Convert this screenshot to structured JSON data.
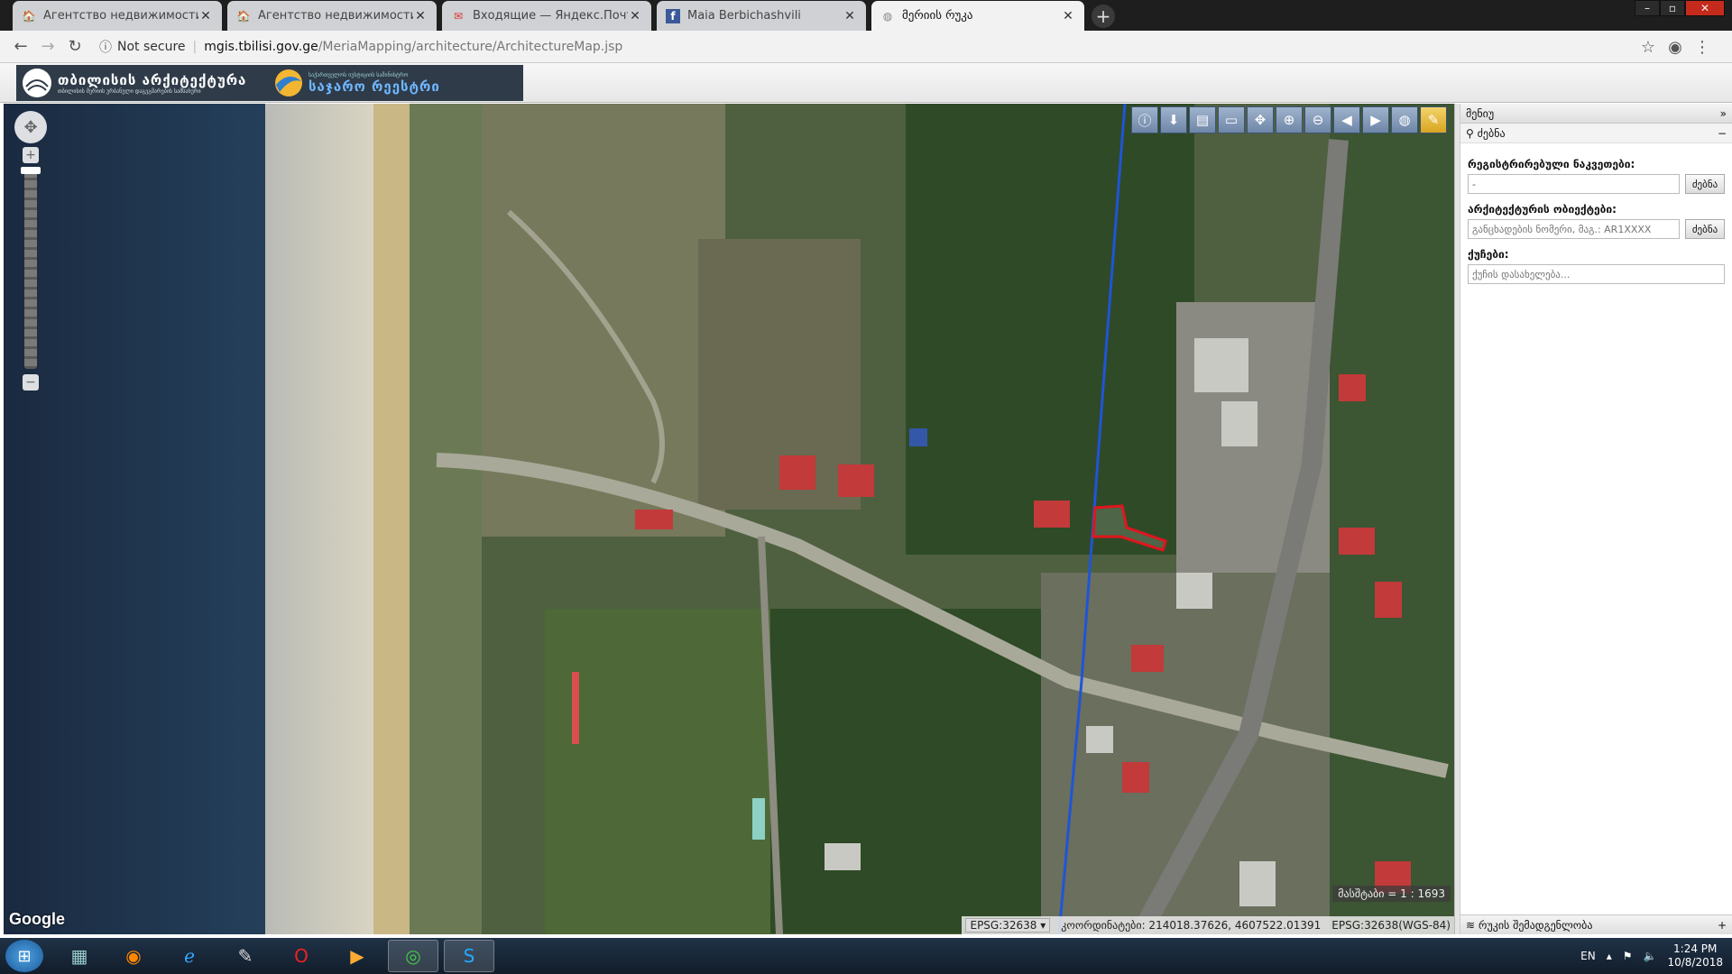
{
  "browser": {
    "tabs": [
      {
        "title": "Агентство недвижимости Batum",
        "icon": "site-favicon",
        "active": false
      },
      {
        "title": "Агентство недвижимости Batum",
        "icon": "site-favicon",
        "active": false
      },
      {
        "title": "Входящие — Яндекс.Почта",
        "icon": "mail-favicon",
        "active": false
      },
      {
        "title": "Maia Berbichashvili",
        "icon": "facebook-favicon",
        "active": false
      },
      {
        "title": "მერიის რუკა",
        "icon": "globe-favicon",
        "active": true
      }
    ],
    "address": {
      "secure_label": "Not secure",
      "host": "mgis.tbilisi.gov.ge",
      "path": "/MeriaMapping/architecture/ArchitectureMap.jsp"
    }
  },
  "site": {
    "logo_main": "თბილისის არქიტექტურა",
    "logo_main_sub": "თბილისის მერიის ურბანული დაგეგმარების სამსახური",
    "logo_registry": "საჯარო რეესტრი",
    "logo_registry_sub": "საქართველოს იუსტიციის სამინისტრო"
  },
  "map": {
    "attribution": "Google",
    "scale_label": "მასშტაბი = 1 : 1693",
    "epsg_select": "EPSG:32638",
    "coords_label": "კოორდინატები: 214018.37626, 4607522.01391",
    "coords_crs": "EPSG:32638(WGS-84)",
    "tools": [
      "info-icon",
      "download-icon",
      "print-icon",
      "measure-icon",
      "pan-icon",
      "zoom-in-icon",
      "zoom-out-icon",
      "zoom-prev-icon",
      "zoom-next-icon",
      "full-extent-icon",
      "draw-icon"
    ]
  },
  "panel": {
    "title": "მენიუ",
    "search_header": "ძებნა",
    "field1": {
      "label": "რეგისტრირებული ნაკვეთები:",
      "value": "-",
      "button": "ძებნა"
    },
    "field2": {
      "label": "არქიტექტურის ობიექტები:",
      "placeholder": "განცხადების ნომერი, მაგ.: AR1XXXX",
      "button": "ძებნა"
    },
    "field3": {
      "label": "ქუჩები:",
      "placeholder": "ქუჩის დასახელება..."
    },
    "footer": "რუკის შემადგენლობა"
  },
  "taskbar": {
    "apps": [
      "file-manager-icon",
      "firefox-icon",
      "ie-icon",
      "paint-icon",
      "opera-icon",
      "media-player-icon",
      "chrome-icon",
      "skype-icon"
    ],
    "lang": "EN",
    "time": "1:24 PM",
    "date": "10/8/2018"
  },
  "colors": {
    "route_line": "#1f55d6",
    "parcel_highlight": "#e0151d",
    "sea": "#1d2e44"
  }
}
